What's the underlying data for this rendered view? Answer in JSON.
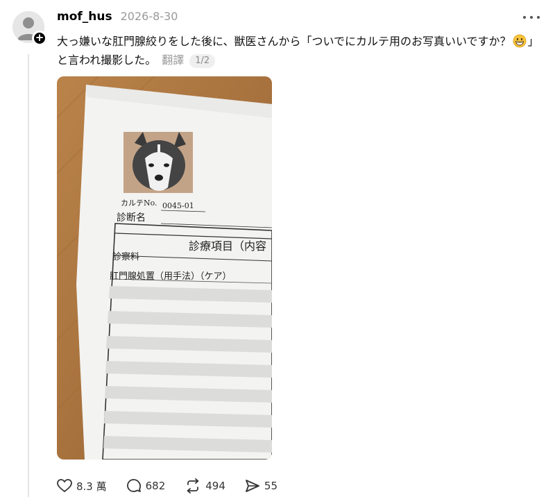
{
  "post": {
    "username": "mof_hus",
    "timestamp": "2026-8-30",
    "text_main": "大っ嫌いな肛門腺絞りをした後に、獣医さんから「ついでにカルテ用のお写真いいですか？",
    "emoji_name": "grinning-face-emoji",
    "text_tail": "」と言われ撮影した。",
    "translate_label": "翻譯",
    "page_indicator": "1/2"
  },
  "photo": {
    "chart_no_label": "カルテNo.",
    "chart_no_value": "0045-01",
    "diagnosis_label": "診断名",
    "section_header": "診療項目（内容",
    "row1": "診察料",
    "row2": "肛門腺処置（用手法）（ケア）"
  },
  "actions": {
    "likes": "8.3 萬",
    "comments": "682",
    "reposts": "494",
    "shares": "55"
  }
}
